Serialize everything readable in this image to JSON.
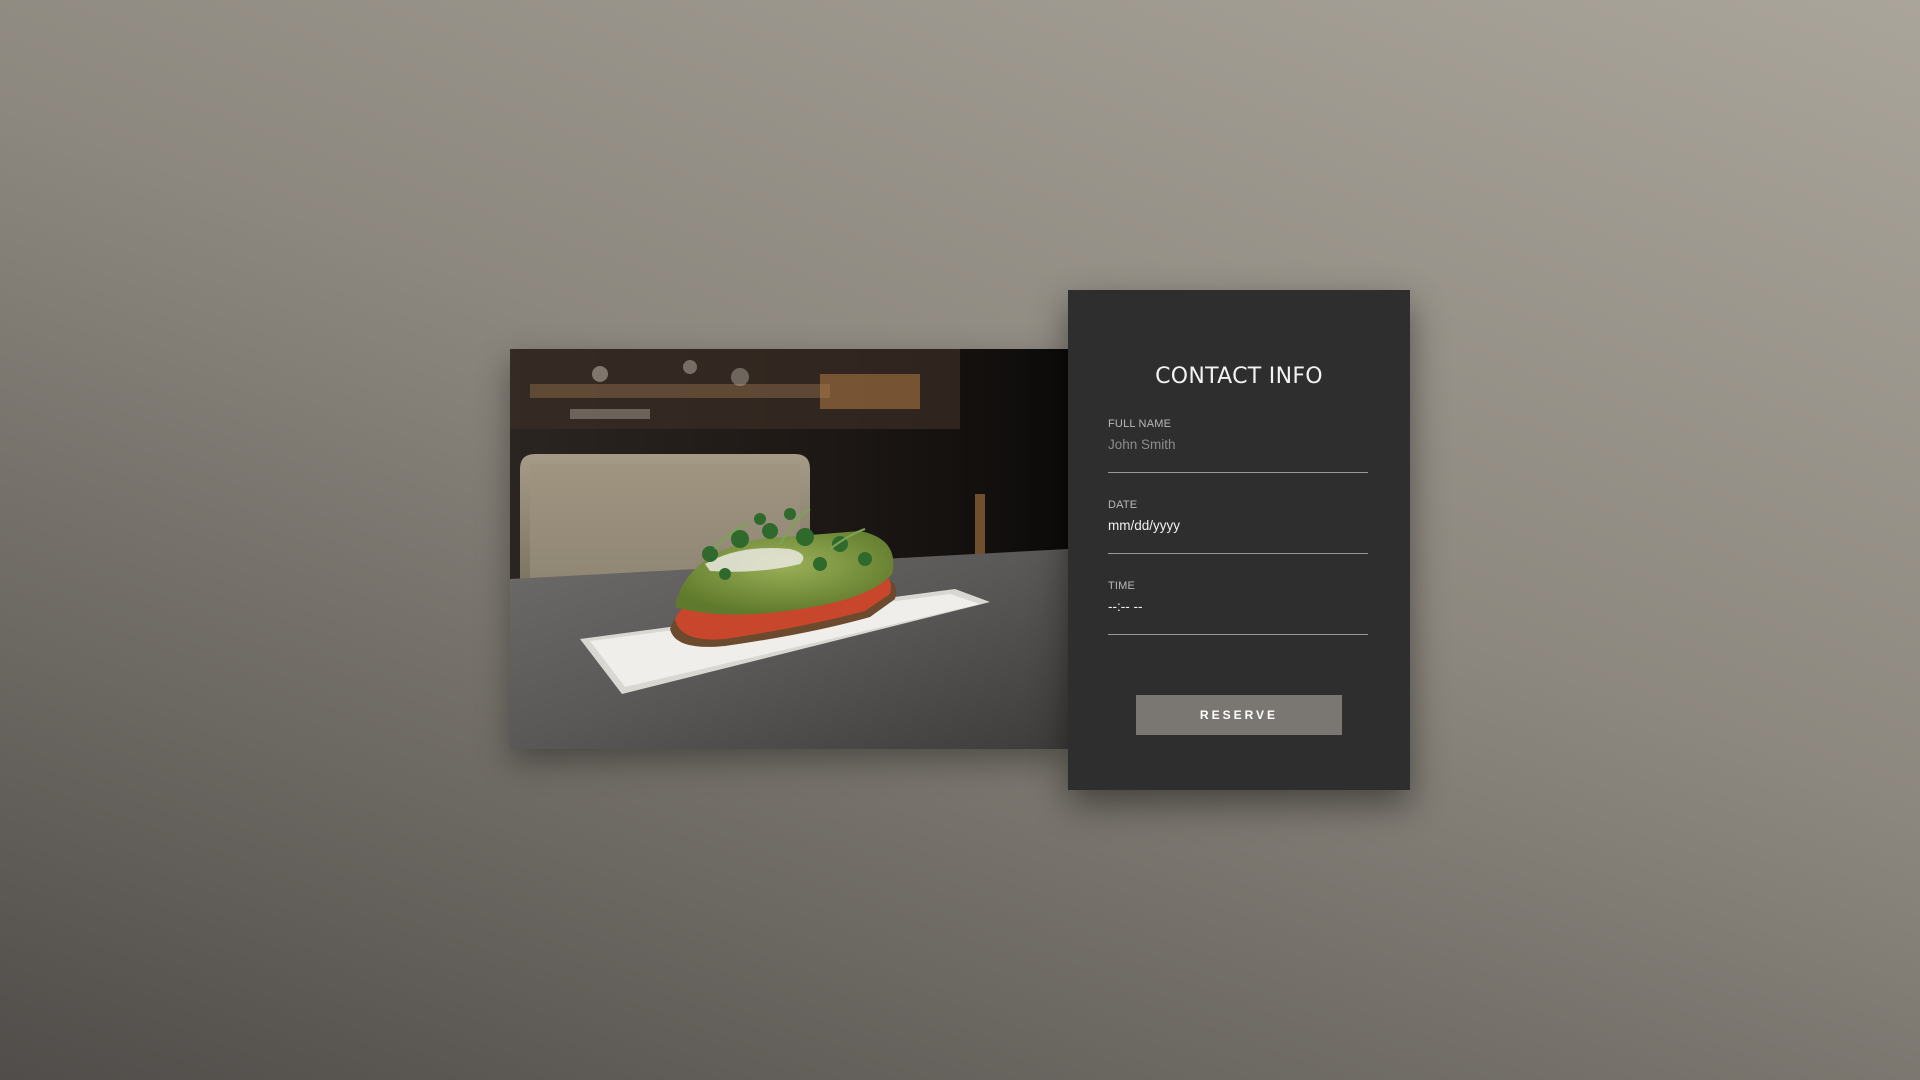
{
  "form": {
    "title": "CONTACT INFO",
    "full_name": {
      "label": "FULL NAME",
      "placeholder": "John Smith"
    },
    "date": {
      "label": "DATE",
      "value": "mm/dd/yyyy"
    },
    "time": {
      "label": "TIME",
      "value": "--:-- --"
    },
    "reserve_label": "RESERVE"
  },
  "colors": {
    "card_background": "#2e2e2e",
    "button_background": "#7a7672",
    "underline": "#9a9a9a"
  },
  "photo": {
    "subject": "avocado-toast-on-white-plate-photo"
  }
}
